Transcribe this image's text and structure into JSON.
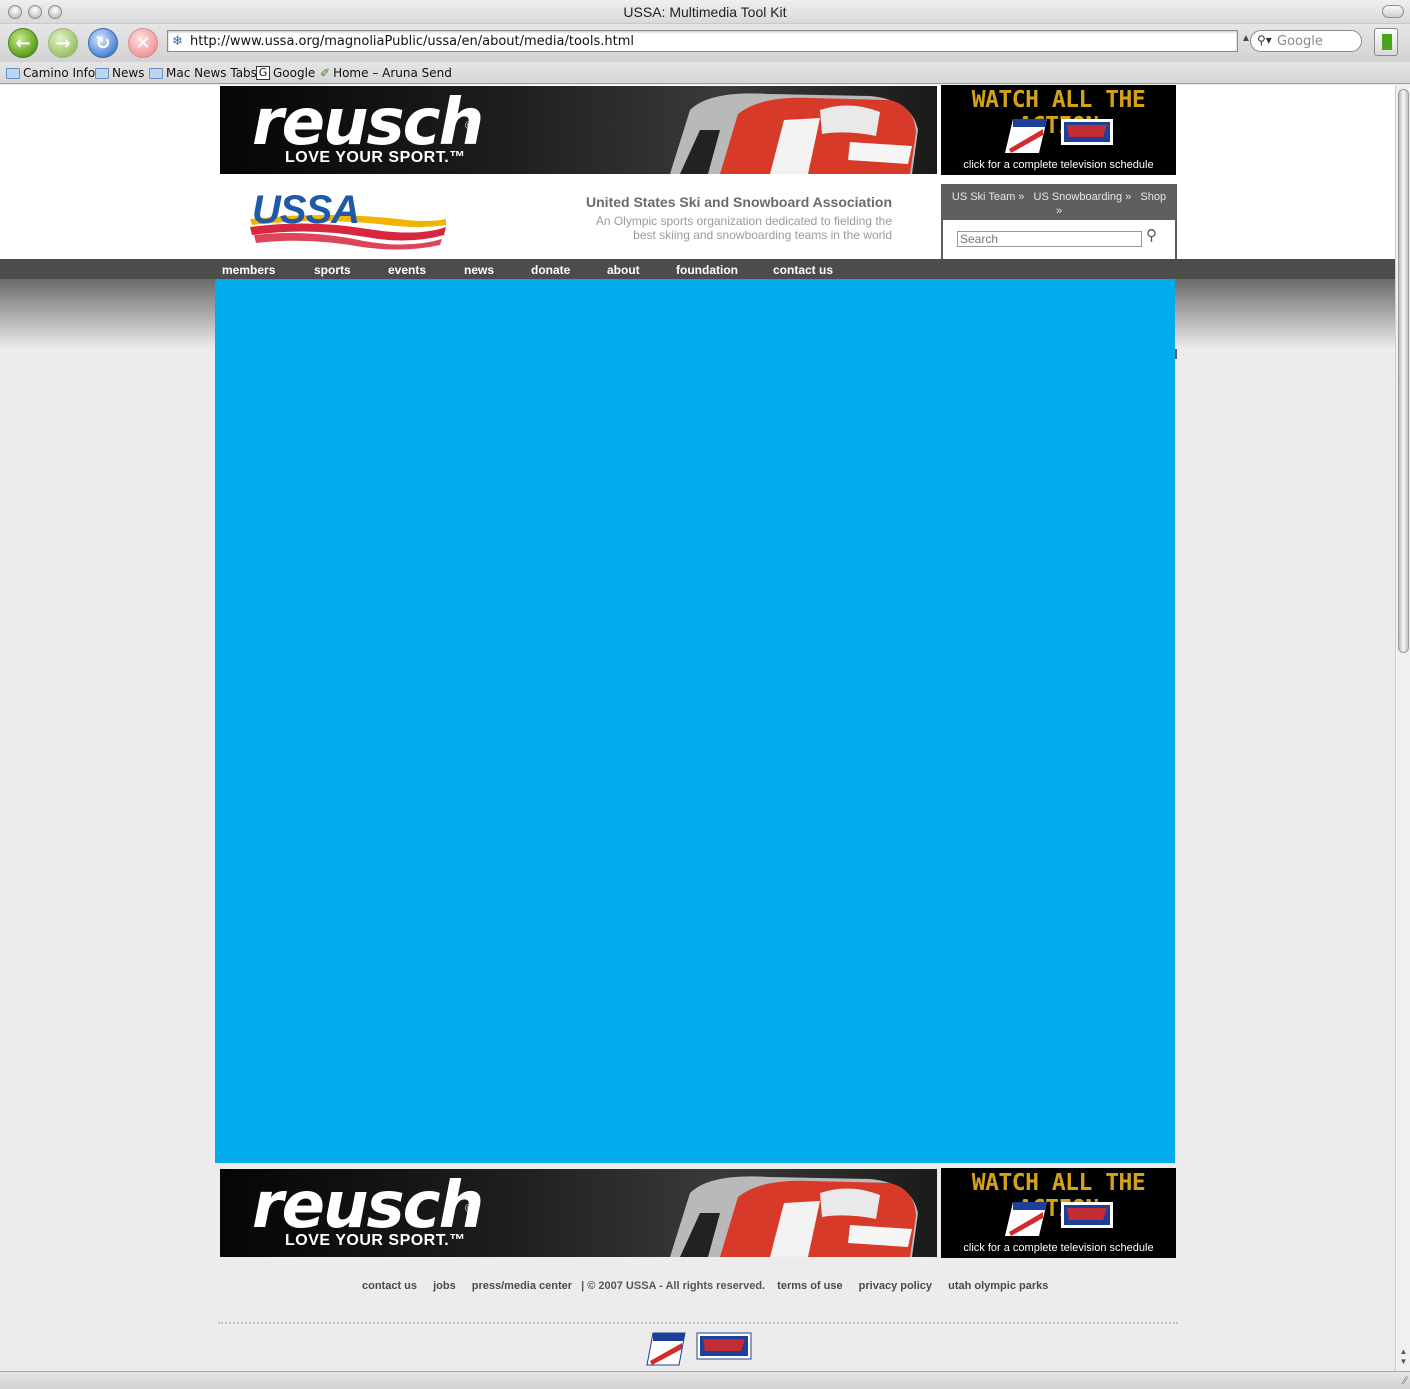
{
  "window": {
    "title": "USSA: Multimedia Tool Kit"
  },
  "toolbar": {
    "url": "http://www.ussa.org/magnoliaPublic/ussa/en/about/media/tools.html",
    "search_placeholder": "Google"
  },
  "bookmarks": [
    "Camino Info",
    "News",
    "Mac News Tabs",
    "Google",
    "Home – Aruna Send"
  ],
  "ads": {
    "reusch_brand": "reusch",
    "reusch_tagline": "LOVE YOUR SPORT.™",
    "watch_headline": "WATCH ALL THE ACTION",
    "watch_caption": "click for a complete television schedule",
    "logo_ski": "US SKI TEAM",
    "logo_snow": "SNOWBOARDING"
  },
  "header": {
    "logo_text": "USSA",
    "org_name": "United States Ski and Snowboard Association",
    "org_desc_line1": "An Olympic sports organization dedicated to fielding the",
    "org_desc_line2": "best skiing and snowboarding teams in the world"
  },
  "quicklinks": {
    "ski_team": "US Ski Team »",
    "snowboarding": "US Snowboarding »",
    "shop": "Shop",
    "shop_arrow": "»",
    "search_placeholder": "Search"
  },
  "nav": [
    "members",
    "sports",
    "events",
    "news",
    "donate",
    "about",
    "foundation",
    "contact us"
  ],
  "footer": {
    "links": [
      "contact us",
      "jobs",
      "press/media center"
    ],
    "copyright": "| © 2007 USSA - All rights reserved.",
    "links2": [
      "terms of use",
      "privacy policy",
      "utah olympic parks"
    ]
  },
  "colors": {
    "content_blue": "#00acec",
    "nav_dark": "#4c4c4c",
    "watch_gold": "#d4a21a"
  }
}
